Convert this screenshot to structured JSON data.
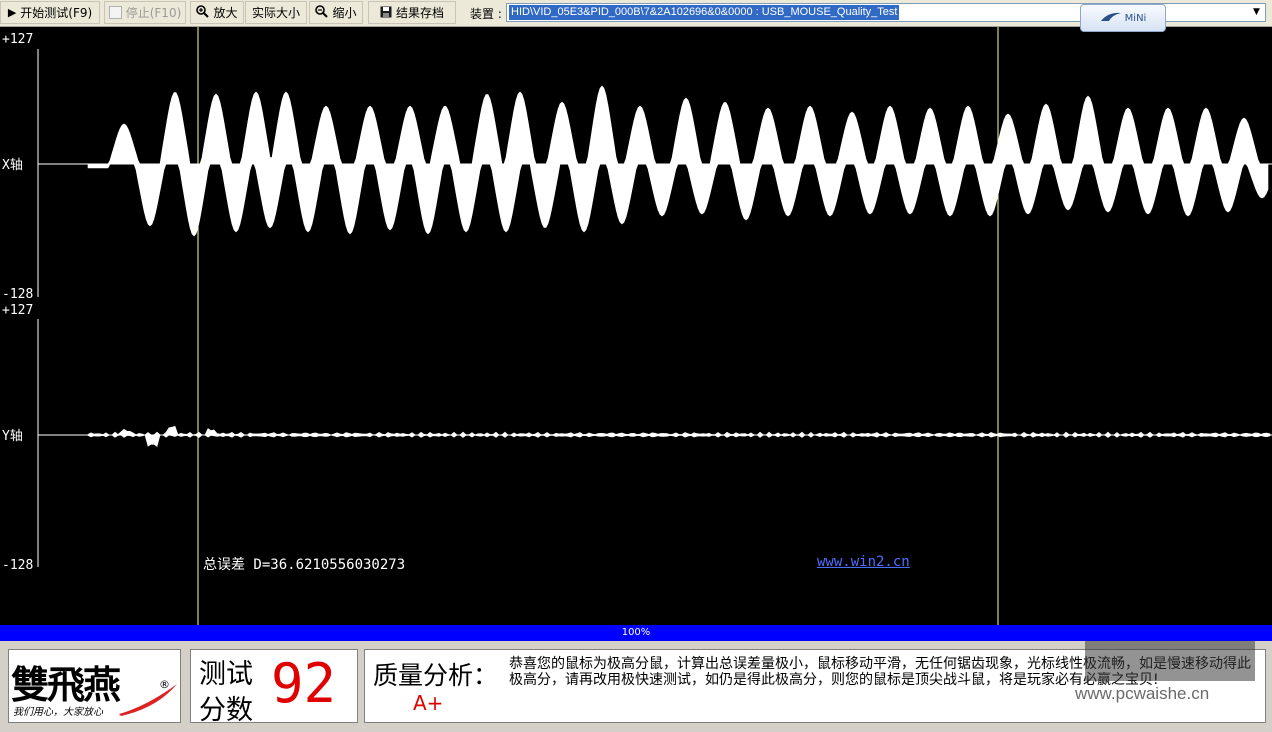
{
  "toolbar": {
    "start_label": "开始测试(F9)",
    "stop_label": "停止(F10)",
    "zoom_in_label": "放大",
    "actual_size_label": "实际大小",
    "zoom_out_label": "缩小",
    "save_label": "结果存档",
    "device_label": "装置 :",
    "device_value": "HID\\VID_05E3&PID_000B\\7&2A102696&0&0000  :  USB_MOUSE_Quality_Test",
    "mini_label": "MiNi"
  },
  "plot": {
    "x_axis": {
      "label": "X轴",
      "max_label": "+127",
      "min_label": "-128"
    },
    "y_axis": {
      "label": "Y轴",
      "max_label": "+127",
      "min_label": "-128"
    },
    "error_text": "总误差 D=36.6210556030273",
    "site_link": "www.win2.cn"
  },
  "progress": {
    "value": 100,
    "label": "100%"
  },
  "bottom": {
    "logo_text": "雙飛燕",
    "logo_reg": "®",
    "logo_slogan": "我们用心，大家放心",
    "score_label_1": "测试",
    "score_label_2": "分数",
    "score_value": "92",
    "analysis_title": "质量分析：",
    "grade": "A+",
    "analysis_text": "恭喜您的鼠标为极高分鼠，计算出总误差量极小，鼠标移动平滑，无任何锯齿现象，光标线性极流畅，如是慢速移动得此极高分，请再改用极快速测试，如仍是得此极高分，则您的鼠标是顶尖战斗鼠，将是玩家必有必赢之宝贝!",
    "watermark": "www.pcwaishe.cn"
  },
  "colors": {
    "plot_bg": "#000000",
    "wave": "#ffffff",
    "progress": "#0000ff",
    "score": "#e00000",
    "link": "#4e6cff"
  }
}
